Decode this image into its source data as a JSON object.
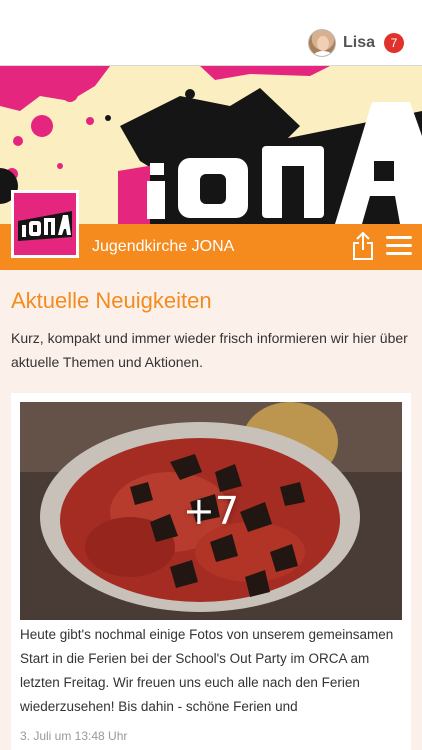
{
  "user": {
    "name": "Lisa",
    "notification_count": "7"
  },
  "banner": {
    "logo_text": "JONA"
  },
  "page": {
    "name": "Jugendkirche JONA",
    "logo_text": "JONA"
  },
  "colors": {
    "accent": "#f58a1f",
    "badge": "#e1312c",
    "brand_pink": "#e5267e",
    "content_bg": "#fcf1ea"
  },
  "section": {
    "title": "Aktuelle Neuigkeiten",
    "intro": "Kurz, kompakt und immer wieder frisch informieren wir hier über aktuelle Themen und Aktionen."
  },
  "post": {
    "more_photos": "+7",
    "text": "Heute gibt's nochmal einige Fotos von unserem gemeinsamen Start in die Ferien bei der School's Out Party im ORCA am letzten Freitag. Wir freuen uns euch alle nach den Ferien wiederzusehen! Bis dahin - schöne Ferien und",
    "time": "3. Juli um 13:48 Uhr"
  }
}
